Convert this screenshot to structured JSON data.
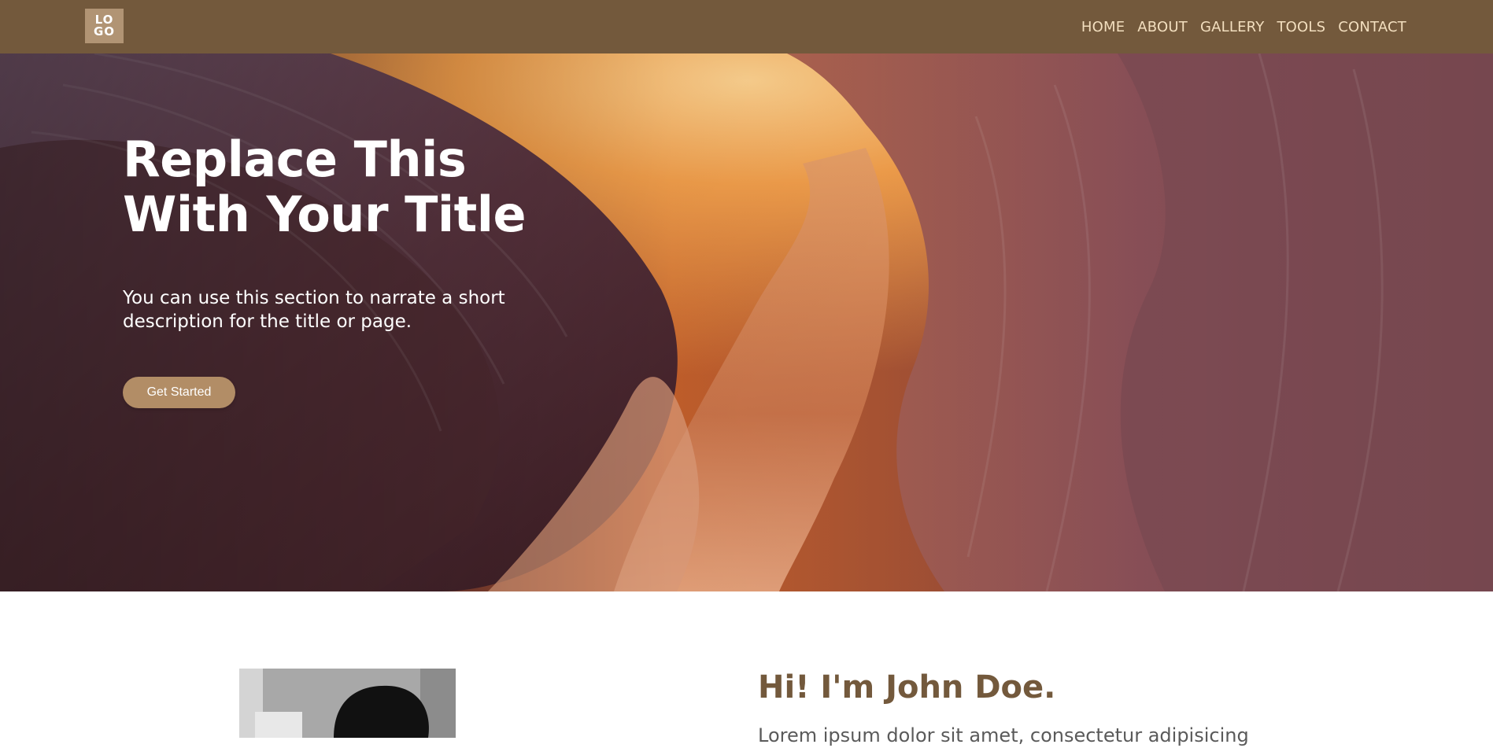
{
  "header": {
    "logo_line1": "LO",
    "logo_line2": "GO",
    "nav": [
      {
        "label": "HOME"
      },
      {
        "label": "ABOUT"
      },
      {
        "label": "GALLERY"
      },
      {
        "label": "TOOLS"
      },
      {
        "label": "CONTACT"
      }
    ]
  },
  "hero": {
    "title_line1": "Replace This",
    "title_line2": "With Your Title",
    "description": "You can use this section to narrate a short description for the title or page.",
    "button_label": "Get Started"
  },
  "about": {
    "heading": "Hi! I'm John Doe.",
    "text": "Lorem ipsum dolor sit amet, consectetur adipisicing"
  },
  "colors": {
    "header_bg": "#73593c",
    "logo_bg": "#b19474",
    "nav_text": "#f3dfbf",
    "button_bg": "#b28d66",
    "heading_brown": "#73593c"
  }
}
